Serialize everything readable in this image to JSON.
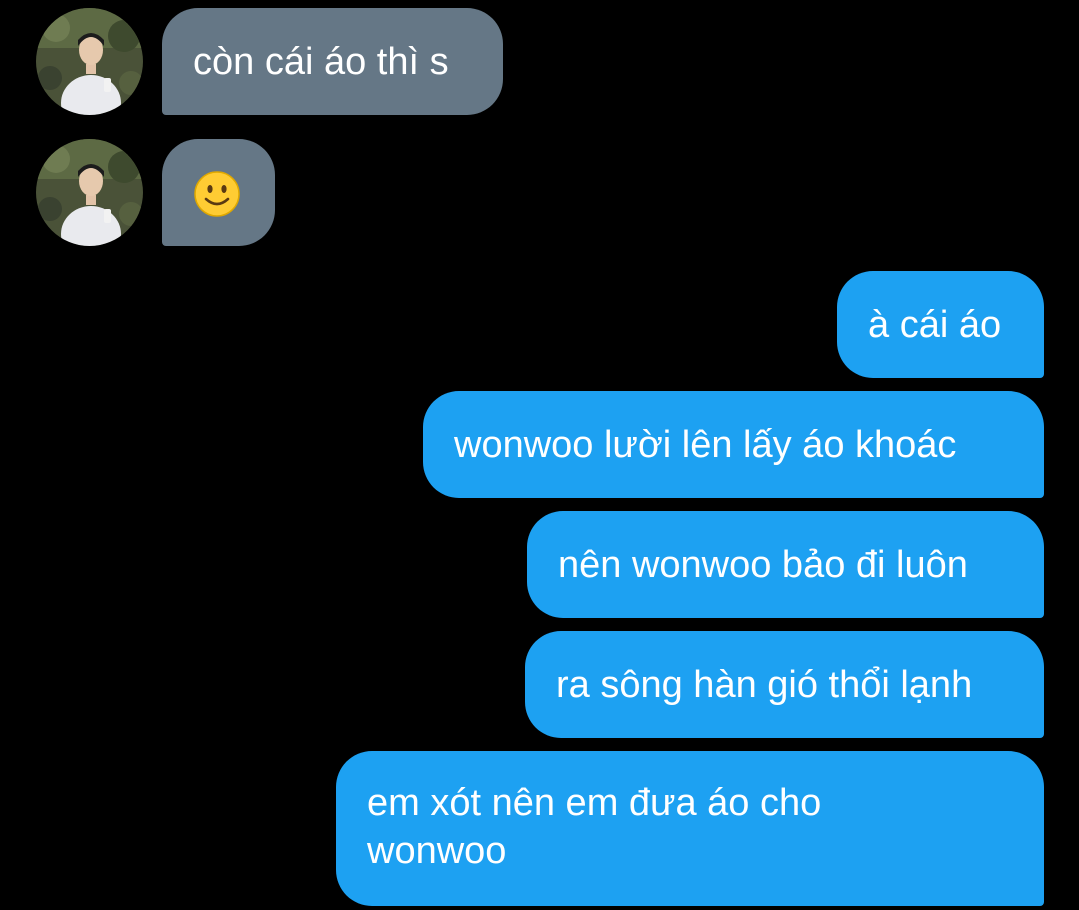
{
  "thread": {
    "incoming": [
      {
        "text": "còn cái áo thì s",
        "avatar_icon": "user-avatar-photo"
      },
      {
        "text": "",
        "emoji": "slightly-smiling-face-icon",
        "avatar_icon": "user-avatar-photo"
      }
    ],
    "outgoing": [
      {
        "text": "à cái áo"
      },
      {
        "text": "wonwoo lười lên lấy áo khoác"
      },
      {
        "text": "nên wonwoo bảo đi luôn"
      },
      {
        "text": "ra sông hàn gió thổi lạnh"
      },
      {
        "text": "em xót nên em đưa áo cho wonwoo"
      }
    ]
  },
  "colors": {
    "background": "#000000",
    "incoming_bubble": "#657786",
    "outgoing_bubble": "#1da1f2",
    "text": "#ffffff"
  }
}
